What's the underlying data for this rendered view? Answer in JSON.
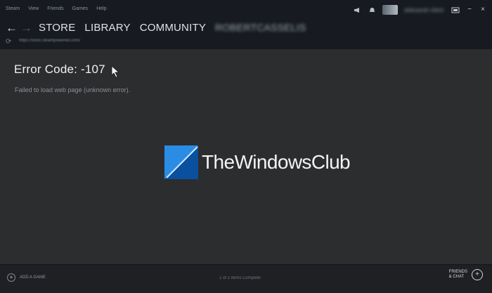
{
  "window": {
    "menu": [
      "Steam",
      "View",
      "Friends",
      "Games",
      "Help"
    ],
    "username": "aleksandr-client",
    "system_icons": {
      "announcement": "megaphone-icon",
      "notifications": "bell-icon",
      "avatar": "avatar",
      "screen": "window-icon",
      "minimize": "minimize-icon",
      "close": "close-icon"
    }
  },
  "navigation": {
    "back": "←",
    "forward": "→",
    "links": [
      "STORE",
      "LIBRARY",
      "COMMUNITY",
      "ROBERTCASSELIS"
    ]
  },
  "address": {
    "url": "https://store.steampowered.com/"
  },
  "content": {
    "error_title": "Error Code: -107",
    "error_message": "Failed to load web page (unknown error)."
  },
  "watermark": {
    "brand": "TheWindowsClub"
  },
  "footer": {
    "add_label": "ADD A GAME",
    "status": "1 of 2 Items Complete",
    "friends_line1": "FRIENDS",
    "friends_line2": "& CHAT"
  },
  "colors": {
    "background": "#2a2b2d",
    "header": "#171a21",
    "logo_blue": "#1e9fe3"
  }
}
